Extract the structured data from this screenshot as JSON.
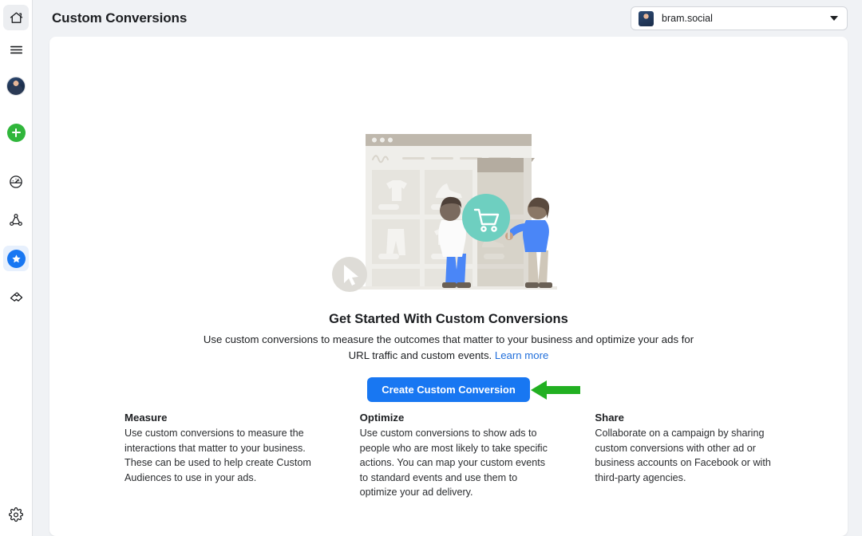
{
  "rail": {
    "items": [
      {
        "name": "home-icon",
        "label": "Home",
        "state": "selected-grey"
      },
      {
        "name": "menu-icon",
        "label": "All tools",
        "state": "none"
      },
      {
        "name": "avatar",
        "label": "Profile",
        "state": "none"
      },
      {
        "name": "plus-icon",
        "label": "Create",
        "state": "none"
      },
      {
        "name": "gauge-icon",
        "label": "Performance",
        "state": "none"
      },
      {
        "name": "network-icon",
        "label": "Audiences",
        "state": "none"
      },
      {
        "name": "star-icon",
        "label": "Events Manager",
        "state": "selected-blue"
      },
      {
        "name": "handshake-icon",
        "label": "Partnerships",
        "state": "none"
      }
    ],
    "settings_label": "Settings"
  },
  "header": {
    "title": "Custom Conversions",
    "account": {
      "name": "bram.social",
      "caret": "chevron-down-icon"
    }
  },
  "hero": {
    "headline": "Get Started With Custom Conversions",
    "description": "Use custom conversions to measure the outcomes that matter to your business and optimize your ads for URL traffic and custom events.",
    "learn_more": "Learn more",
    "cta_label": "Create Custom Conversion",
    "annotation_arrow": "green-left-arrow"
  },
  "columns": [
    {
      "title": "Measure",
      "body": "Use custom conversions to measure the interactions that matter to your business. These can be used to help create Custom Audiences to use in your ads."
    },
    {
      "title": "Optimize",
      "body": "Use custom conversions to show ads to people who are most likely to take specific actions. You can map your custom events to standard events and use them to optimize your ad delivery."
    },
    {
      "title": "Share",
      "body": "Collaborate on a campaign by sharing custom conversions with other ad or business accounts on Facebook or with third-party agencies."
    }
  ],
  "colors": {
    "page_bg": "#f0f2f5",
    "cta_blue": "#1877f2",
    "link_blue": "#216fdb",
    "arrow_green": "#22b022",
    "cart_teal": "#6ecfc0",
    "text_primary": "#1c1e21"
  }
}
